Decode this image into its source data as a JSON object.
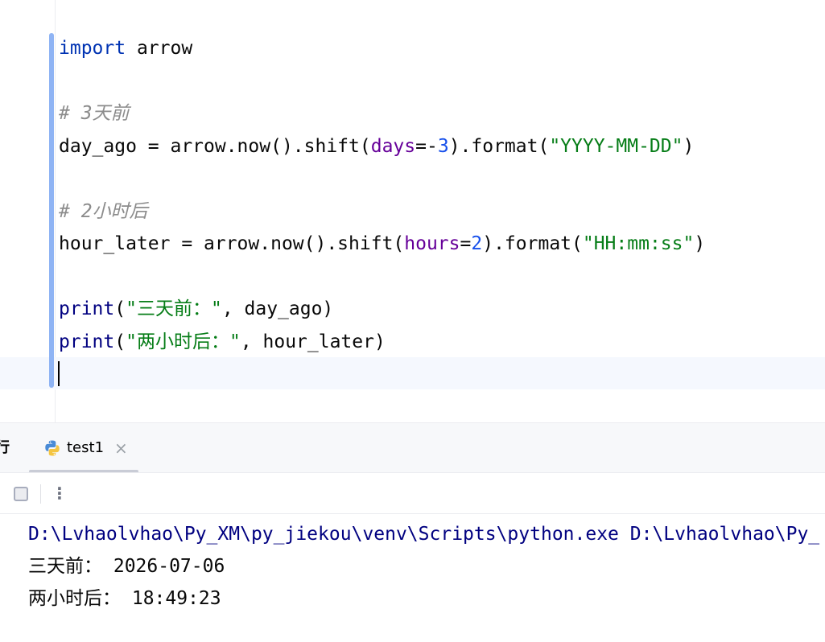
{
  "editor": {
    "lines": [
      {
        "tokens": [
          {
            "t": "import",
            "c": "kw"
          },
          {
            "t": " arrow",
            "c": ""
          }
        ]
      },
      {
        "tokens": []
      },
      {
        "tokens": [
          {
            "t": "# 3天前",
            "c": "comment"
          }
        ]
      },
      {
        "tokens": [
          {
            "t": "day_ago = arrow.now().shift(",
            "c": ""
          },
          {
            "t": "days",
            "c": "param"
          },
          {
            "t": "=-",
            "c": ""
          },
          {
            "t": "3",
            "c": "num"
          },
          {
            "t": ").format(",
            "c": ""
          },
          {
            "t": "\"YYYY-MM-DD\"",
            "c": "str"
          },
          {
            "t": ")",
            "c": ""
          }
        ]
      },
      {
        "tokens": []
      },
      {
        "tokens": [
          {
            "t": "# 2小时后",
            "c": "comment"
          }
        ]
      },
      {
        "tokens": [
          {
            "t": "hour_later = arrow.now().shift(",
            "c": ""
          },
          {
            "t": "hours",
            "c": "param"
          },
          {
            "t": "=",
            "c": ""
          },
          {
            "t": "2",
            "c": "num"
          },
          {
            "t": ").format(",
            "c": ""
          },
          {
            "t": "\"HH:mm:ss\"",
            "c": "str"
          },
          {
            "t": ")",
            "c": ""
          }
        ]
      },
      {
        "tokens": []
      },
      {
        "tokens": [
          {
            "t": "print",
            "c": "fn-builtin"
          },
          {
            "t": "(",
            "c": ""
          },
          {
            "t": "\"三天前：\"",
            "c": "str"
          },
          {
            "t": ", day_ago)",
            "c": ""
          }
        ]
      },
      {
        "tokens": [
          {
            "t": "print",
            "c": "fn-builtin"
          },
          {
            "t": "(",
            "c": ""
          },
          {
            "t": "\"两小时后：\"",
            "c": "str"
          },
          {
            "t": ", hour_later)",
            "c": ""
          }
        ]
      }
    ]
  },
  "run_panel": {
    "title_fragment": "行",
    "tab": {
      "label": "test1",
      "icon": "python-icon",
      "close_glyph": "×"
    },
    "toolbar": {
      "stop_icon": "stop-icon",
      "more_glyph": "⋮"
    },
    "console": {
      "command_line": "D:\\Lvhaolvhao\\Py_XM\\py_jiekou\\venv\\Scripts\\python.exe D:\\Lvhaolvhao\\Py_",
      "output_1": "三天前： 2026-07-06",
      "output_2": "两小时后： 18:49:23"
    }
  },
  "colors": {
    "keyword": "#0033b3",
    "string": "#067d17",
    "number": "#1750eb",
    "parameter": "#660099",
    "comment": "#8c8c8c",
    "builtin": "#000080",
    "change_bar": "#8fb4f4"
  }
}
